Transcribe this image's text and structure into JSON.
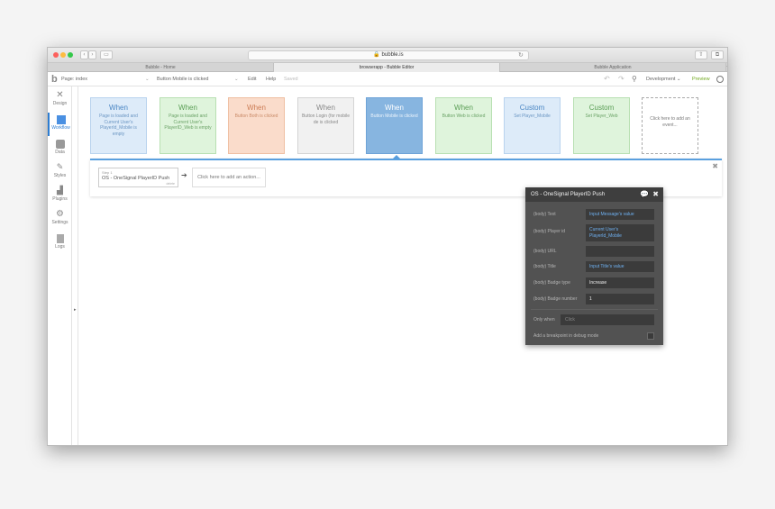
{
  "browser": {
    "url": "🔒 bubble.is",
    "tabs": [
      "Bubble - Home",
      "browserapp - Bubble Editor",
      "Bubble Application"
    ],
    "plus": "+"
  },
  "toolbar": {
    "page_label": "Page: index",
    "page_caret": "⌄",
    "event_select": "Button Mobile is clicked",
    "event_caret": "⌄",
    "edit": "Edit",
    "help": "Help",
    "saved": "Saved",
    "development": "Development ⌄",
    "preview": "Preview"
  },
  "sidebar": {
    "items": [
      {
        "label": "Design",
        "icon": "design-icon"
      },
      {
        "label": "Workflow",
        "icon": "workflow-icon"
      },
      {
        "label": "Data",
        "icon": "data-icon"
      },
      {
        "label": "Styles",
        "icon": "styles-icon"
      },
      {
        "label": "Plugins",
        "icon": "plugins-icon"
      },
      {
        "label": "Settings",
        "icon": "settings-icon"
      },
      {
        "label": "Logs",
        "icon": "logs-icon"
      }
    ]
  },
  "events": [
    {
      "keyword": "When",
      "desc": "Page is loaded and Current User's PlayerId_Mobile is empty",
      "style": "blue"
    },
    {
      "keyword": "When",
      "desc": "Page is loaded and Current User's PlayerID_Web is empty",
      "style": "green"
    },
    {
      "keyword": "When",
      "desc": "Button Both is clicked",
      "style": "orange"
    },
    {
      "keyword": "When",
      "desc": "Button Login (for mobile de is clicked",
      "style": "gray"
    },
    {
      "keyword": "When",
      "desc": "Button Mobile is clicked",
      "style": "selected"
    },
    {
      "keyword": "When",
      "desc": "Button Web is clicked",
      "style": "green"
    },
    {
      "keyword": "Custom",
      "desc": "Set Player_Mobile",
      "style": "blue"
    },
    {
      "keyword": "Custom",
      "desc": "Set Player_Web",
      "style": "green"
    },
    {
      "keyword": "",
      "desc": "Click here to add an event...",
      "style": "add"
    }
  ],
  "actions": {
    "step_label": "Step 1",
    "step_name": "OS - OneSignal PlayerID Push",
    "step_delete": "delete",
    "arrow": "➔",
    "add_action": "Click here to add an action...",
    "close": "✖"
  },
  "props": {
    "title": "OS - OneSignal PlayerID Push",
    "rows": [
      {
        "label": "(body) Text",
        "value": "Input Message's value",
        "kind": "dyn"
      },
      {
        "label": "(body) Player id",
        "value": "Current User's PlayerId_Mobile",
        "kind": "dyn"
      },
      {
        "label": "(body) URL",
        "value": "",
        "kind": "plain"
      },
      {
        "label": "(body) Title",
        "value": "Input Title's value",
        "kind": "dyn"
      },
      {
        "label": "(body) Badge type",
        "value": "Increase",
        "kind": "plain"
      },
      {
        "label": "(body) Badge number",
        "value": "1",
        "kind": "plain"
      }
    ],
    "only_when_label": "Only when",
    "only_when_placeholder": "Click",
    "breakpoint_label": "Add a breakpoint in debug mode"
  },
  "colors": {
    "accent": "#4a90e2",
    "preview": "#6fa71c",
    "panel": "#525252"
  }
}
